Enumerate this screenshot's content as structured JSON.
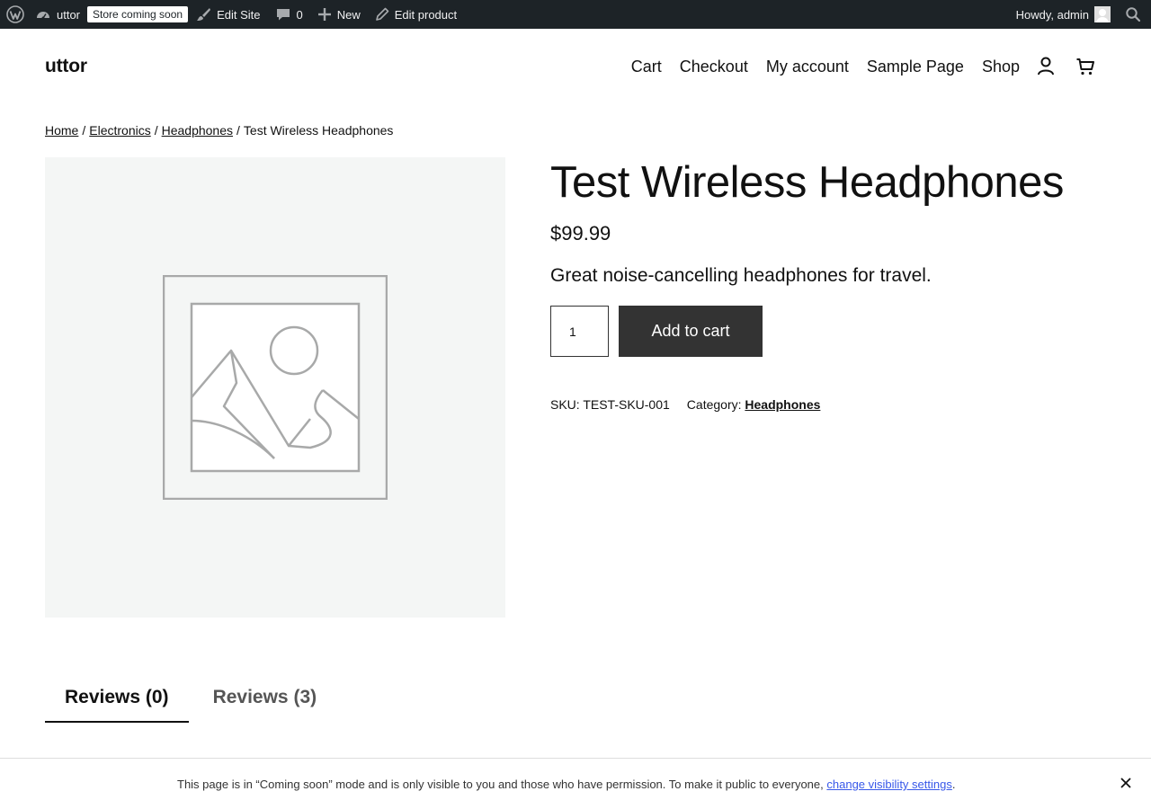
{
  "admin_bar": {
    "site_name": "uttor",
    "store_badge": "Store coming soon",
    "edit_site": "Edit Site",
    "comments_count": "0",
    "new_label": "New",
    "edit_product": "Edit product",
    "howdy": "Howdy, admin"
  },
  "header": {
    "site_title": "uttor",
    "nav": [
      "Cart",
      "Checkout",
      "My account",
      "Sample Page",
      "Shop"
    ]
  },
  "breadcrumb": {
    "items": [
      "Home",
      "Electronics",
      "Headphones"
    ],
    "current": "Test Wireless Headphones",
    "separator": "/"
  },
  "product": {
    "title": "Test Wireless Headphones",
    "price": "$99.99",
    "short_description": "Great noise-cancelling headphones for travel.",
    "quantity": "1",
    "add_to_cart": "Add to cart",
    "sku_label": "SKU: TEST-SKU-001",
    "category_label": "Category:",
    "category": "Headphones"
  },
  "tabs": [
    "Reviews (0)",
    "Reviews (3)"
  ],
  "notice": {
    "text": "This page is in “Coming soon” mode and is only visible to you and those who have permission. To make it public to everyone,",
    "link": "change visibility settings",
    "end": "."
  },
  "colors": {
    "admin_bar_bg": "#1d2327",
    "button_bg": "#333333",
    "image_bg": "#f4f6f5",
    "link_blue": "#3858e9"
  }
}
